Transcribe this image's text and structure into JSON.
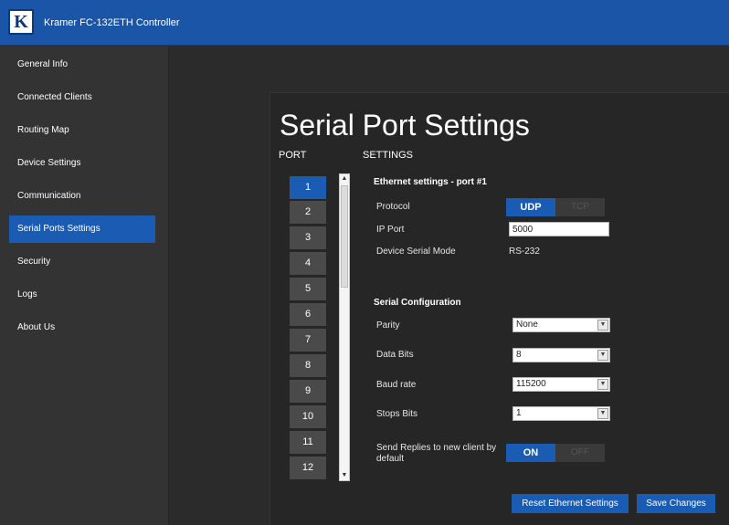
{
  "app": {
    "logo_letter": "K",
    "title": "Kramer FC-132ETH Controller"
  },
  "sidebar": {
    "items": [
      {
        "label": "General Info"
      },
      {
        "label": "Connected Clients"
      },
      {
        "label": "Routing Map"
      },
      {
        "label": "Device Settings"
      },
      {
        "label": "Communication"
      },
      {
        "label": "Serial Ports Settings",
        "active": true
      },
      {
        "label": "Security"
      },
      {
        "label": "Logs"
      },
      {
        "label": "About Us"
      }
    ]
  },
  "page": {
    "title": "Serial Port Settings",
    "port_header": "PORT",
    "settings_header": "SETTINGS"
  },
  "ports": [
    "1",
    "2",
    "3",
    "4",
    "5",
    "6",
    "7",
    "8",
    "9",
    "10",
    "11",
    "12"
  ],
  "selected_port": "1",
  "ethernet": {
    "section_title": "Ethernet settings - port #1",
    "protocol_label": "Protocol",
    "protocol_on": "UDP",
    "protocol_off": "TCP",
    "ip_port_label": "IP Port",
    "ip_port_value": "5000",
    "serial_mode_label": "Device Serial Mode",
    "serial_mode_value": "RS-232"
  },
  "serial": {
    "section_title": "Serial Configuration",
    "parity_label": "Parity",
    "parity_value": "None",
    "data_bits_label": "Data Bits",
    "data_bits_value": "8",
    "baud_label": "Baud rate",
    "baud_value": "115200",
    "stop_bits_label": "Stops Bits",
    "stop_bits_value": "1",
    "send_replies_label": "Send Replies to new client by default",
    "send_replies_on": "ON",
    "send_replies_off": "OFF"
  },
  "actions": {
    "reset_label": "Reset Ethernet Settings",
    "save_label": "Save Changes"
  },
  "colors": {
    "header_blue": "#1a55a8",
    "accent_blue": "#1a5cb4",
    "sidebar": "#333333",
    "background": "#2b2b2b"
  }
}
